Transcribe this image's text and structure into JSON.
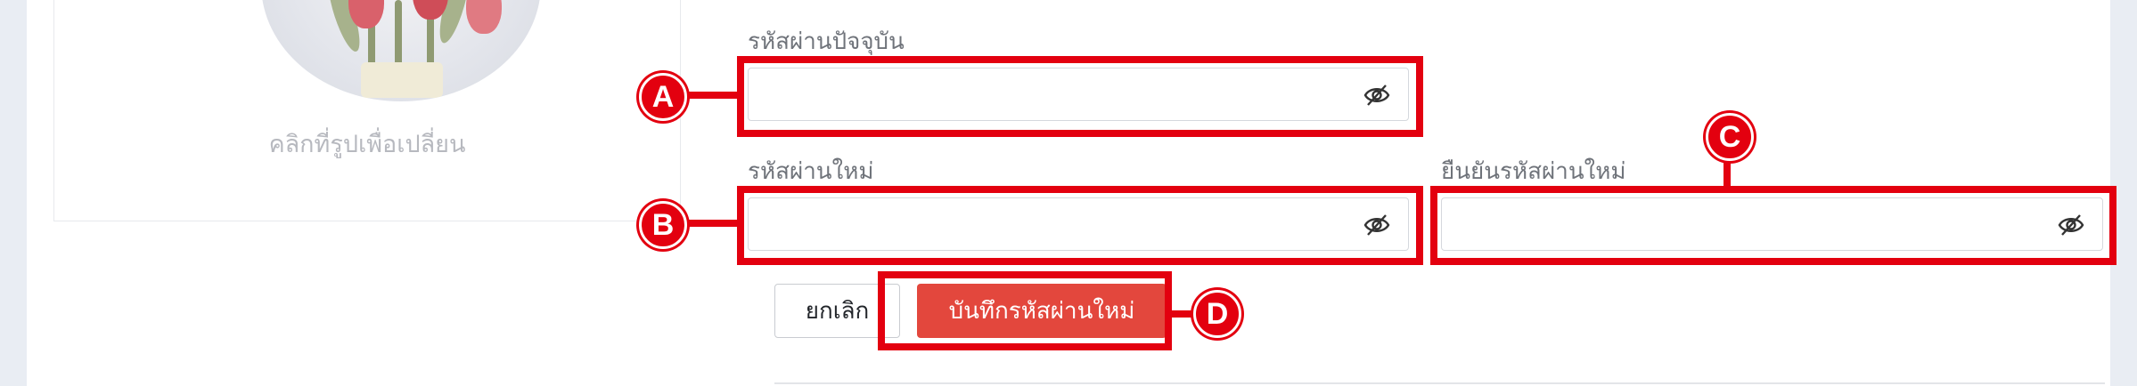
{
  "profile": {
    "change_photo_hint": "คลิกที่รูปเพื่อเปลี่ยน"
  },
  "form": {
    "current_password": {
      "label": "รหัสผ่านปัจจุบัน",
      "value": ""
    },
    "new_password": {
      "label": "รหัสผ่านใหม่",
      "value": ""
    },
    "confirm_password": {
      "label": "ยืนยันรหัสผ่านใหม่",
      "value": ""
    },
    "toggle_icon": "eye-slash-icon",
    "cancel_label": "ยกเลิก",
    "save_label": "บันทึกรหัสผ่านใหม่"
  },
  "annotations": {
    "a": "A",
    "b": "B",
    "c": "C",
    "d": "D",
    "color": "#e3000f"
  },
  "colors": {
    "page_background": "#e9edf3",
    "save_button": "#e3473d"
  }
}
